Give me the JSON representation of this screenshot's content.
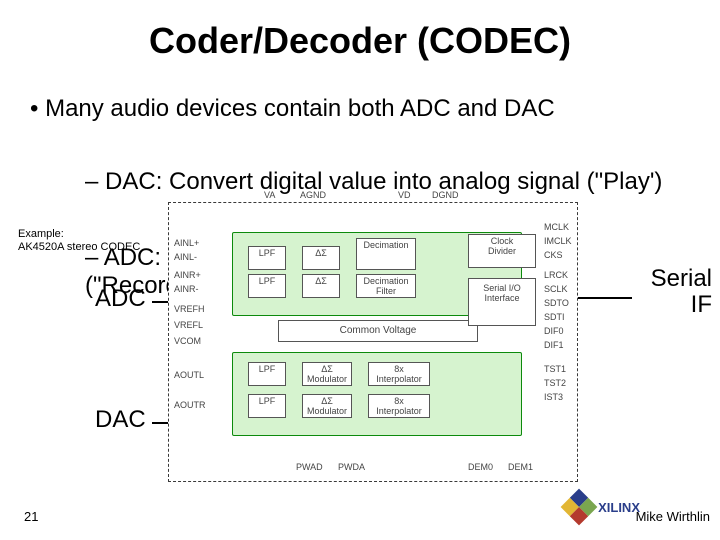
{
  "title": "Coder/Decoder (CODEC)",
  "bullet1": "Many audio devices contain both ADC and DAC",
  "sub_a": "– DAC: Convert digital value into analog signal (\"Play')",
  "sub_b": "– ADC: Convert analog signal into digital value (\"Record\")",
  "example_line1": "Example:",
  "example_line2": "AK4520A stereo CODEC",
  "adc_label": "ADC",
  "dac_label": "DAC",
  "serial_label_l1": "Serial",
  "serial_label_l2": "IF",
  "diagram": {
    "common_voltage": "Common Voltage",
    "serial_io_l1": "Serial I/O",
    "serial_io_l2": "Interface",
    "clock_l1": "Clock",
    "clock_l2": "Divider",
    "lpf": "LPF",
    "ds": "ΔΣ",
    "decimation": "Decimation",
    "decimation_filter": "Decimation Filter",
    "ds_mod": "ΔΣ Modulator",
    "interpolator": "8x Interpolator",
    "pins": {
      "ainlp": "AINL+",
      "ainlm": "AINL-",
      "ainrp": "AINR+",
      "ainrm": "AINR-",
      "vrefh": "VREFH",
      "vrefl": "VREFL",
      "vcom": "VCOM",
      "aoutl": "AOUTL",
      "aoutr": "AOUTR",
      "va": "VA",
      "agnd": "AGND",
      "vd": "VD",
      "dgnd": "DGND",
      "mclk": "MCLK",
      "imclk": "IMCLK",
      "cks": "CKS",
      "lrck": "LRCK",
      "sclk": "SCLK",
      "sdto": "SDTO",
      "sdti": "SDTI",
      "dif0": "DIF0",
      "dif1": "DIF1",
      "tst1": "TST1",
      "tst2": "TST2",
      "ist3": "IST3",
      "pwad": "PWAD",
      "pwda": "PWDA",
      "dem0": "DEM0",
      "dem1": "DEM1"
    }
  },
  "page_number": "21",
  "author": "Mike Wirthlin",
  "logo_text": "XILINX"
}
